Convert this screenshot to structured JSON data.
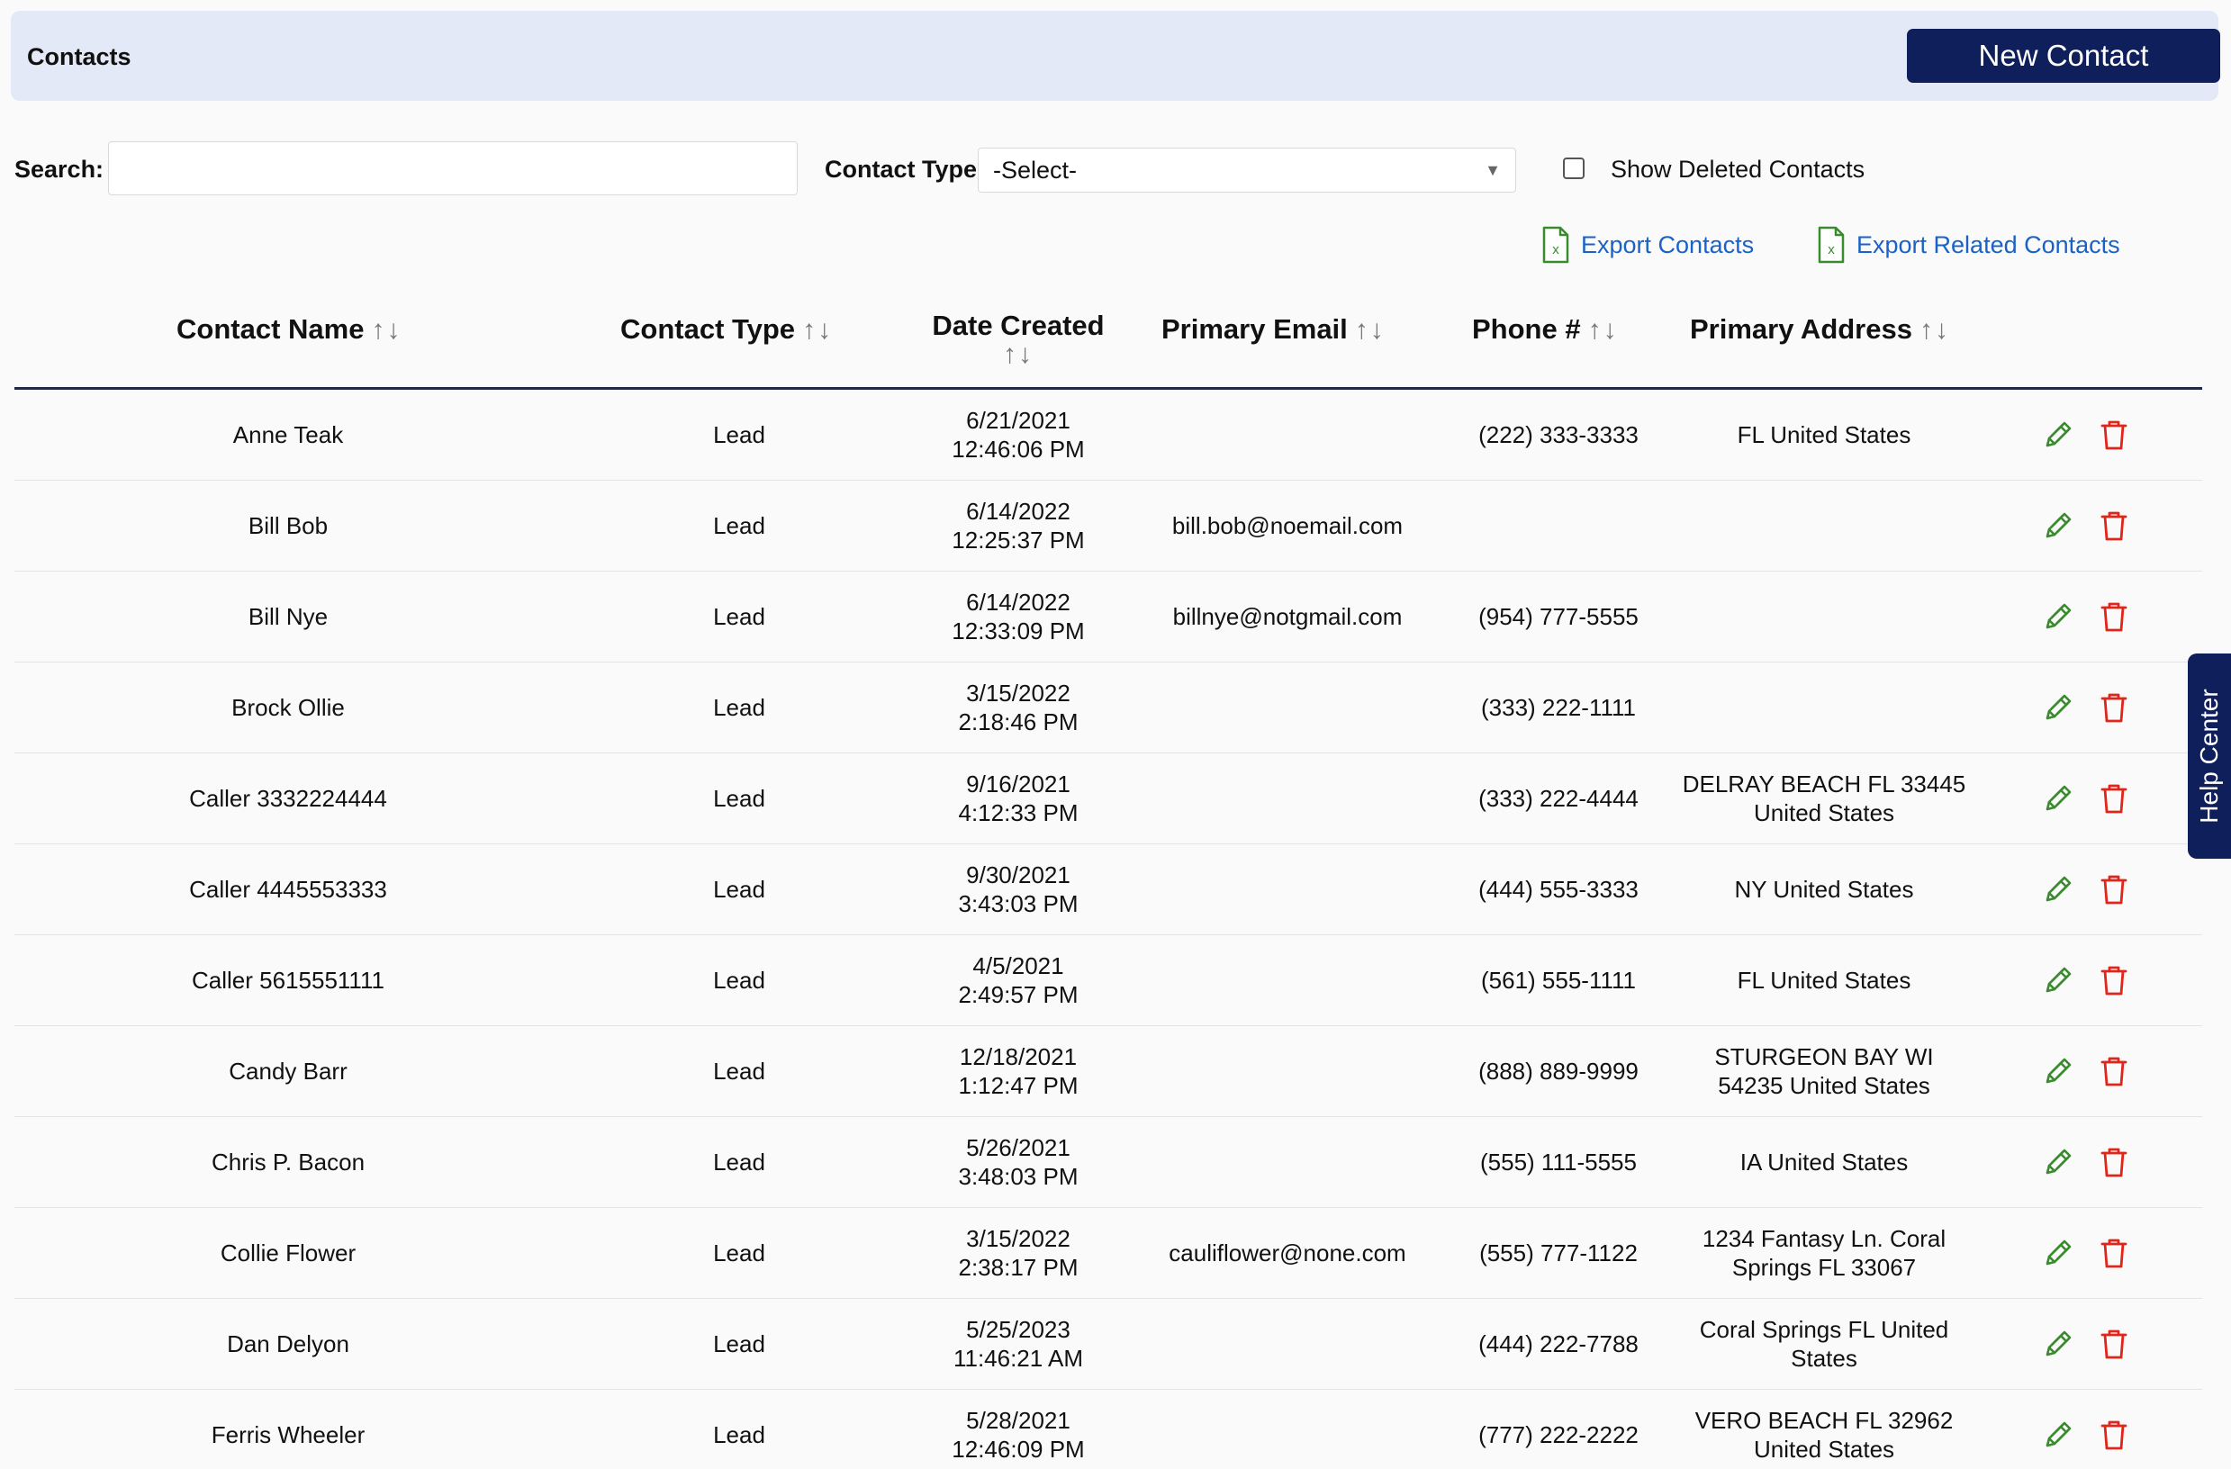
{
  "header": {
    "title": "Contacts",
    "new_contact_label": "New Contact"
  },
  "filters": {
    "search_label": "Search:",
    "search_value": "",
    "contact_type_label": "Contact Type",
    "contact_type_selected": "-Select-",
    "show_deleted_label": "Show Deleted Contacts",
    "show_deleted_checked": false
  },
  "exports": {
    "export_contacts_label": "Export Contacts",
    "export_related_label": "Export Related Contacts"
  },
  "table": {
    "headers": {
      "name": "Contact Name",
      "type": "Contact Type",
      "date": "Date Created",
      "email": "Primary Email",
      "phone": "Phone #",
      "address": "Primary Address"
    },
    "rows": [
      {
        "name": "Anne Teak",
        "type": "Lead",
        "date": "6/21/2021",
        "time": "12:46:06 PM",
        "email": "",
        "phone": "(222) 333-3333",
        "addr1": "FL United States",
        "addr2": ""
      },
      {
        "name": "Bill Bob",
        "type": "Lead",
        "date": "6/14/2022",
        "time": "12:25:37 PM",
        "email": "bill.bob@noemail.com",
        "phone": "",
        "addr1": "",
        "addr2": ""
      },
      {
        "name": "Bill Nye",
        "type": "Lead",
        "date": "6/14/2022",
        "time": "12:33:09 PM",
        "email": "billnye@notgmail.com",
        "phone": "(954) 777-5555",
        "addr1": "",
        "addr2": ""
      },
      {
        "name": "Brock Ollie",
        "type": "Lead",
        "date": "3/15/2022",
        "time": "2:18:46 PM",
        "email": "",
        "phone": "(333) 222-1111",
        "addr1": "",
        "addr2": ""
      },
      {
        "name": "Caller 3332224444",
        "type": "Lead",
        "date": "9/16/2021",
        "time": "4:12:33 PM",
        "email": "",
        "phone": "(333) 222-4444",
        "addr1": "DELRAY BEACH FL 33445",
        "addr2": "United States"
      },
      {
        "name": "Caller 4445553333",
        "type": "Lead",
        "date": "9/30/2021",
        "time": "3:43:03 PM",
        "email": "",
        "phone": "(444) 555-3333",
        "addr1": "NY United States",
        "addr2": ""
      },
      {
        "name": "Caller 5615551111",
        "type": "Lead",
        "date": "4/5/2021",
        "time": "2:49:57 PM",
        "email": "",
        "phone": "(561) 555-1111",
        "addr1": "FL United States",
        "addr2": ""
      },
      {
        "name": "Candy Barr",
        "type": "Lead",
        "date": "12/18/2021",
        "time": "1:12:47 PM",
        "email": "",
        "phone": "(888) 889-9999",
        "addr1": "STURGEON BAY WI",
        "addr2": "54235 United States"
      },
      {
        "name": "Chris P. Bacon",
        "type": "Lead",
        "date": "5/26/2021",
        "time": "3:48:03 PM",
        "email": "",
        "phone": "(555) 111-5555",
        "addr1": "IA United States",
        "addr2": ""
      },
      {
        "name": "Collie Flower",
        "type": "Lead",
        "date": "3/15/2022",
        "time": "2:38:17 PM",
        "email": "cauliflower@none.com",
        "phone": "(555) 777-1122",
        "addr1": "1234 Fantasy Ln. Coral",
        "addr2": "Springs FL 33067"
      },
      {
        "name": "Dan Delyon",
        "type": "Lead",
        "date": "5/25/2023",
        "time": "11:46:21 AM",
        "email": "",
        "phone": "(444) 222-7788",
        "addr1": "Coral Springs FL United",
        "addr2": "States"
      },
      {
        "name": "Ferris Wheeler",
        "type": "Lead",
        "date": "5/28/2021",
        "time": "12:46:09 PM",
        "email": "",
        "phone": "(777) 222-2222",
        "addr1": "VERO BEACH FL 32962",
        "addr2": "United States"
      }
    ]
  },
  "help": {
    "label": "Help Center"
  },
  "colors": {
    "primary_navy": "#0f1f5c",
    "header_bg": "#e3e9f6",
    "link_blue": "#1a62c6",
    "edit_green": "#3a8a2e",
    "delete_red": "#e0261b"
  },
  "icons": {
    "edit": "pencil-icon",
    "delete": "trash-icon",
    "export": "excel-file-icon",
    "sort": "sort-arrows-icon",
    "dropdown": "chevron-down-icon"
  }
}
